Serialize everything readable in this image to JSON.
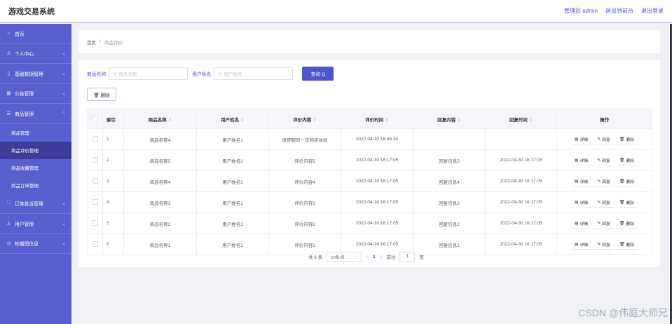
{
  "header": {
    "app_title": "游戏交易系统",
    "admin_label": "管理员 admin",
    "back_front": "退出到前台",
    "logout": "退出登录"
  },
  "sidebar": {
    "items": [
      {
        "label": "首页",
        "icon": "home-icon",
        "glyph": "⌂"
      },
      {
        "label": "个人中心",
        "icon": "user-icon",
        "glyph": "♙",
        "chev": "⌄"
      },
      {
        "label": "基础数据管理",
        "icon": "tablet-icon",
        "glyph": "▯",
        "chev": "⌄"
      },
      {
        "label": "公告管理",
        "icon": "grid-icon",
        "glyph": "▦",
        "chev": "⌄"
      },
      {
        "label": "商品管理",
        "icon": "list-icon",
        "glyph": "☰",
        "chev": "⌃"
      }
    ],
    "sub_items": [
      {
        "label": "商品管理",
        "active": false
      },
      {
        "label": "商品评价管理",
        "active": true
      },
      {
        "label": "商品收藏管理",
        "active": false
      },
      {
        "label": "商品订单管理",
        "active": false
      }
    ],
    "items_after": [
      {
        "label": "订单投诉管理",
        "icon": "chart-icon",
        "glyph": "⛶",
        "chev": "⌄"
      },
      {
        "label": "用户管理",
        "icon": "user-icon",
        "glyph": "♙",
        "chev": "⌄"
      },
      {
        "label": "轮播图信息",
        "icon": "circle-icon",
        "glyph": "◎",
        "chev": "⌄"
      }
    ]
  },
  "breadcrumb": {
    "home": "首页",
    "sep": "/",
    "current": "商品评价"
  },
  "search": {
    "name_label": "商品名称",
    "name_placeholder": "商品名称",
    "user_label": "用户姓名",
    "user_placeholder": "用户姓名",
    "query_label": "查询 Q",
    "search_glyph": "Q"
  },
  "toolbar": {
    "delete_label": "🗑 删除"
  },
  "table": {
    "headers": [
      "索引",
      "商品名称",
      "用户姓名",
      "评价内容",
      "评价时间",
      "回复内容",
      "回复时间",
      "操作"
    ],
    "sort_glyph": "⇕",
    "rows": [
      [
        "1",
        "商品名称4",
        "用户姓名1",
        "很舒服的一次购买体验",
        "2022-04-30 16:45:34",
        "",
        ""
      ],
      [
        "2",
        "商品名称5",
        "用户姓名2",
        "评价内容5",
        "2022-04-30 16:17:05",
        "回复信息5",
        "2022-04-30 16:17:05"
      ],
      [
        "3",
        "商品名称4",
        "用户姓名3",
        "评价内容4",
        "2022-04-30 16:17:05",
        "回复信息4",
        "2022-04-30 16:17:05"
      ],
      [
        "4",
        "商品名称3",
        "用户姓名1",
        "评价内容3",
        "2022-04-30 16:17:05",
        "回复信息3",
        "2022-04-30 16:17:05"
      ],
      [
        "5",
        "商品名称2",
        "用户姓名1",
        "评价内容2",
        "2022-04-30 16:17:05",
        "回复信息2",
        "2022-04-30 16:17:05"
      ],
      [
        "6",
        "商品名称1",
        "用户姓名1",
        "评价内容1",
        "2022-04-30 16:17:05",
        "回复信息1",
        "2022-04-30 16:17:05"
      ]
    ],
    "actions": [
      {
        "label": "详情",
        "glyph": "▤",
        "icon": "detail-icon"
      },
      {
        "label": "回复",
        "glyph": "✎",
        "icon": "edit-icon"
      },
      {
        "label": "删除",
        "glyph": "🗑",
        "icon": "trash-icon"
      }
    ]
  },
  "pagination": {
    "total": "共 6 条",
    "page_size": "10条/页",
    "prev": "<",
    "current": "1",
    "next": ">",
    "goto_label": "前往",
    "goto_value": "1",
    "page_unit": "页",
    "dropdown_glyph": "⌄"
  },
  "watermark": "CSDN @伟庭大师兄"
}
